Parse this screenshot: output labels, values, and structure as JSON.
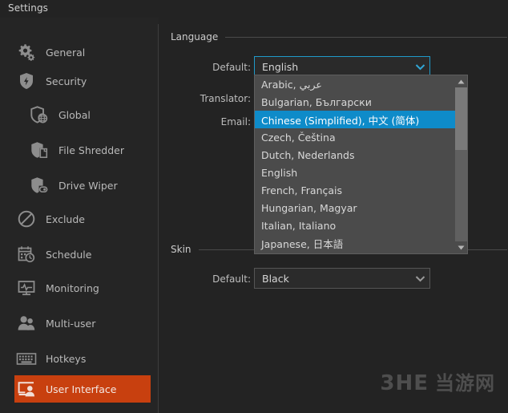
{
  "window": {
    "title": "Settings"
  },
  "sidebar": {
    "items": [
      {
        "label": "General",
        "icon": "gear-icon",
        "indent": false,
        "selected": false
      },
      {
        "label": "Security",
        "icon": "shield-bolt-icon",
        "indent": false,
        "selected": false
      },
      {
        "label": "Global",
        "icon": "shield-globe-icon",
        "indent": true,
        "selected": false
      },
      {
        "label": "File Shredder",
        "icon": "shield-file-icon",
        "indent": true,
        "selected": false
      },
      {
        "label": "Drive Wiper",
        "icon": "shield-drive-icon",
        "indent": true,
        "selected": false
      },
      {
        "label": "Exclude",
        "icon": "no-entry-icon",
        "indent": false,
        "selected": false
      },
      {
        "label": "Schedule",
        "icon": "calendar-clock-icon",
        "indent": false,
        "selected": false
      },
      {
        "label": "Monitoring",
        "icon": "monitor-pulse-icon",
        "indent": false,
        "selected": false
      },
      {
        "label": "Multi-user",
        "icon": "users-icon",
        "indent": false,
        "selected": false
      },
      {
        "label": "Hotkeys",
        "icon": "keyboard-icon",
        "indent": false,
        "selected": false
      },
      {
        "label": "User Interface",
        "icon": "monitor-user-icon",
        "indent": false,
        "selected": true
      }
    ]
  },
  "main": {
    "language_group": {
      "title": "Language",
      "default_label": "Default:",
      "default_value": "English",
      "translator_label": "Translator:",
      "email_label": "Email:"
    },
    "skin_group": {
      "title": "Skin",
      "default_label": "Default:",
      "default_value": "Black"
    }
  },
  "dropdown": {
    "open": true,
    "items": [
      {
        "label": "Arabic, عربي",
        "highlighted": false
      },
      {
        "label": "Bulgarian, Български",
        "highlighted": false
      },
      {
        "label": "Chinese (Simplified), 中文 (简体)",
        "highlighted": true
      },
      {
        "label": "Czech, Čeština",
        "highlighted": false
      },
      {
        "label": "Dutch, Nederlands",
        "highlighted": false
      },
      {
        "label": "English",
        "highlighted": false
      },
      {
        "label": "French, Français",
        "highlighted": false
      },
      {
        "label": "Hungarian, Magyar",
        "highlighted": false
      },
      {
        "label": "Italian, Italiano",
        "highlighted": false
      },
      {
        "label": "Japanese, 日本語",
        "highlighted": false
      }
    ],
    "scrollbar": {
      "up_arrow": "scroll-up-arrow-icon",
      "down_arrow": "scroll-down-arrow-icon"
    }
  },
  "watermark": {
    "latin": "3HE",
    "chinese": "当游网"
  },
  "colors": {
    "accent_orange": "#c8400f",
    "focus_blue": "#1f9ac9",
    "highlight_blue": "#0e8bc9",
    "window_bg": "#232323",
    "sidebar_bg": "#252525",
    "dropdown_bg": "#4b4b4b"
  }
}
